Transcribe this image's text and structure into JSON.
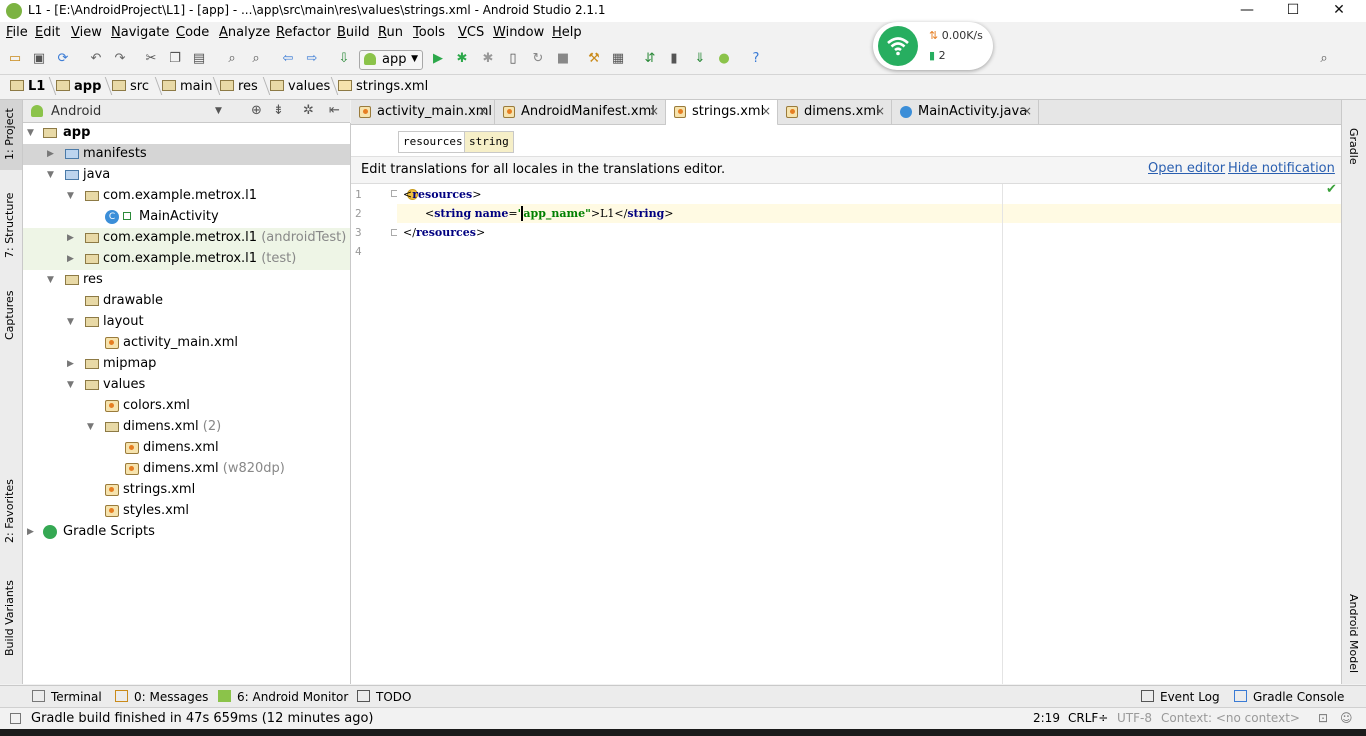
{
  "window": {
    "title": "L1 - [E:\\AndroidProject\\L1] - [app] - ...\\app\\src\\main\\res\\values\\strings.xml - Android Studio 2.1.1",
    "minimize": "—",
    "maximize": "☐",
    "close": "✕"
  },
  "menu": [
    "File",
    "Edit",
    "View",
    "Navigate",
    "Code",
    "Analyze",
    "Refactor",
    "Build",
    "Run",
    "Tools",
    "VCS",
    "Window",
    "Help"
  ],
  "toolbar": {
    "run_config": "app"
  },
  "wifi_widget": {
    "speed": "0.00K/s",
    "count": "2"
  },
  "breadcrumb": [
    "L1",
    "app",
    "src",
    "main",
    "res",
    "values",
    "strings.xml"
  ],
  "left_stripe": [
    "1: Project",
    "7: Structure",
    "Captures",
    "2: Favorites",
    "Build Variants"
  ],
  "right_stripe": [
    "Gradle",
    "Android Model"
  ],
  "project_panel": {
    "view": "Android"
  },
  "tree": [
    {
      "label": "app",
      "suffix": ""
    },
    {
      "label": "manifests",
      "suffix": ""
    },
    {
      "label": "java",
      "suffix": ""
    },
    {
      "label": "com.example.metrox.l1",
      "suffix": ""
    },
    {
      "label": "MainActivity",
      "suffix": ""
    },
    {
      "label": "com.example.metrox.l1",
      "suffix": "(androidTest)"
    },
    {
      "label": "com.example.metrox.l1",
      "suffix": "(test)"
    },
    {
      "label": "res",
      "suffix": ""
    },
    {
      "label": "drawable",
      "suffix": ""
    },
    {
      "label": "layout",
      "suffix": ""
    },
    {
      "label": "activity_main.xml",
      "suffix": ""
    },
    {
      "label": "mipmap",
      "suffix": ""
    },
    {
      "label": "values",
      "suffix": ""
    },
    {
      "label": "colors.xml",
      "suffix": ""
    },
    {
      "label": "dimens.xml",
      "suffix": "(2)"
    },
    {
      "label": "dimens.xml",
      "suffix": ""
    },
    {
      "label": "dimens.xml",
      "suffix": "(w820dp)"
    },
    {
      "label": "strings.xml",
      "suffix": ""
    },
    {
      "label": "styles.xml",
      "suffix": ""
    },
    {
      "label": "Gradle Scripts",
      "suffix": ""
    }
  ],
  "editor_tabs": [
    "activity_main.xml",
    "AndroidManifest.xml",
    "strings.xml",
    "dimens.xml",
    "MainActivity.java"
  ],
  "tab_close": "×",
  "tag_path": [
    "resources",
    "string"
  ],
  "notification": {
    "message": "Edit translations for all locales in the translations editor.",
    "open_editor": "Open editor",
    "hide": "Hide notification"
  },
  "code": {
    "line_numbers": [
      "1",
      "2",
      "3",
      "4"
    ],
    "l1_open": "<",
    "l1_tag": "resources",
    "l1_close": ">",
    "l2_open": "<",
    "l2_tag": "string",
    "l2_attr": "name",
    "l2_eq": "=",
    "l2_value": "\"app_name\"",
    "l2_text": ">L1</",
    "l2_tag_end": "string",
    "l2_close": ">",
    "l3_open": "</",
    "l3_tag": "resources",
    "l3_close": ">"
  },
  "bottom_tabs": {
    "terminal": "Terminal",
    "messages": "0: Messages",
    "monitor": "6: Android Monitor",
    "todo": "TODO",
    "event_log": "Event Log",
    "gradle_console": "Gradle Console"
  },
  "status": {
    "message": "Gradle build finished in 47s 659ms (12 minutes ago)",
    "position": "2:19",
    "line_sep": "CRLF÷",
    "encoding": "UTF-8",
    "context": "Context: <no context>"
  },
  "colors": {
    "accent_green": "#27ae60",
    "link": "#2a5fb0",
    "keyword": "#000080",
    "string": "#008000"
  }
}
